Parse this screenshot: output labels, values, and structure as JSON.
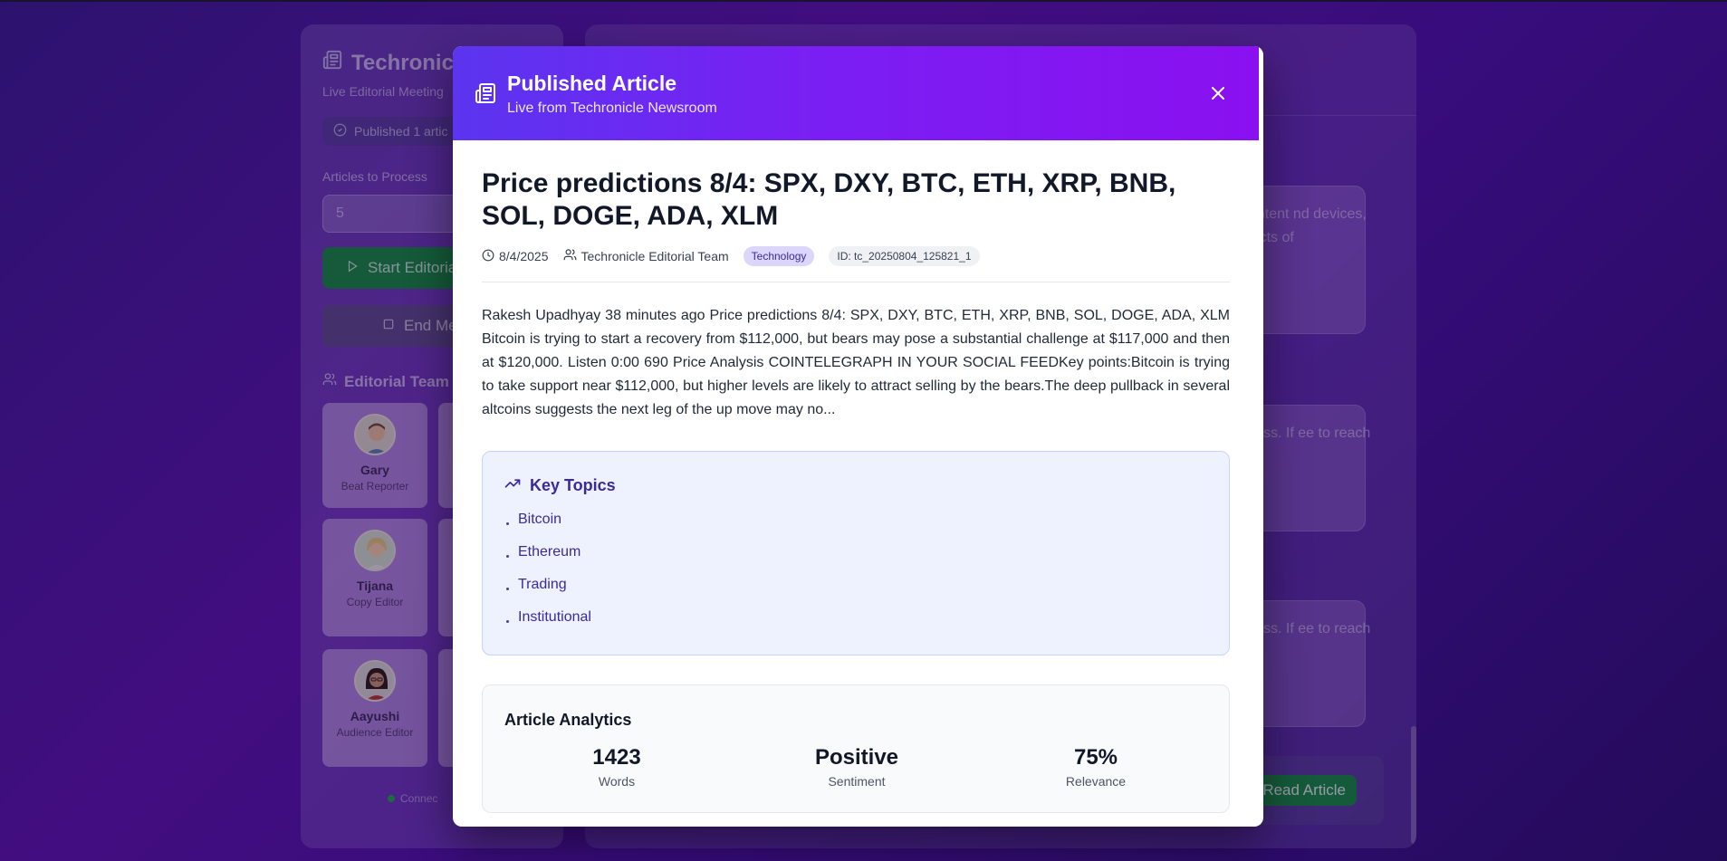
{
  "sidebar": {
    "title": "Techronicl",
    "subtitle": "Live Editorial Meeting",
    "status_badge": "Published 1 artic",
    "articles_label": "Articles to Process",
    "articles_value": "5",
    "start_button": "Start Editoria",
    "end_button": "End Mee",
    "team_heading": "Editorial Team",
    "team": [
      {
        "name": "Gary",
        "role": "Beat Reporter"
      },
      {
        "name": "Tijana",
        "role": "Copy Editor"
      },
      {
        "name": "Aayushi",
        "role": "Audience Editor"
      }
    ],
    "connection_status": "Connec"
  },
  "main": {
    "cards": [
      {
        "text": "orm content nd devices, al aspects of"
      },
      {
        "text": "w process. If ee to reach fe..."
      },
      {
        "text": "w process. If ee to reach fe..."
      }
    ],
    "read_button": "Read Article"
  },
  "modal": {
    "header": {
      "title": "Published Article",
      "subtitle": "Live from Techronicle Newsroom"
    },
    "article": {
      "title": "Price predictions 8/4: SPX, DXY, BTC, ETH, XRP, BNB, SOL, DOGE, ADA, XLM",
      "date": "8/4/2025",
      "author": "Techronicle Editorial Team",
      "category": "Technology",
      "id_label": "ID: tc_20250804_125821_1",
      "body": "Rakesh Upadhyay 38 minutes ago Price predictions 8/4: SPX, DXY, BTC, ETH, XRP, BNB, SOL, DOGE, ADA, XLM Bitcoin is trying to start a recovery from $112,000, but bears may pose a substantial challenge at $117,000 and then at $120,000. Listen 0:00 690 Price Analysis COINTELEGRAPH IN YOUR SOCIAL FEEDKey points:Bitcoin is trying to take support near $112,000, but higher levels are likely to attract selling by the bears.The deep pullback in several altcoins suggests the next leg of the up move may no..."
    },
    "key_topics": {
      "heading": "Key Topics",
      "items": [
        "Bitcoin",
        "Ethereum",
        "Trading",
        "Institutional"
      ]
    },
    "analytics": {
      "heading": "Article Analytics",
      "stats": [
        {
          "value": "1423",
          "label": "Words"
        },
        {
          "value": "Positive",
          "label": "Sentiment"
        },
        {
          "value": "75%",
          "label": "Relevance"
        }
      ]
    }
  },
  "colors": {
    "header_gradient_start": "#5b35f0",
    "header_gradient_end": "#8a10f0",
    "accent_green": "#16873d",
    "topics_bg": "#eef2ff",
    "topics_text": "#3b2a9a"
  }
}
